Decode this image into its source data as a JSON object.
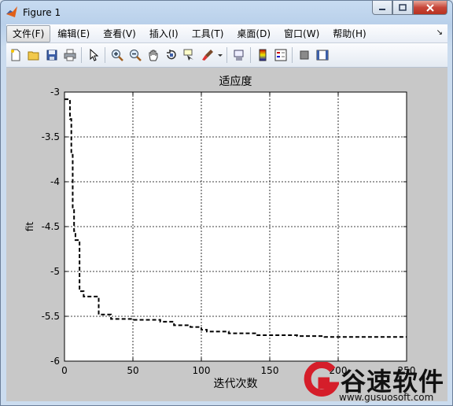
{
  "window": {
    "title": "Figure 1"
  },
  "menu": [
    {
      "label": "文件(F)"
    },
    {
      "label": "编辑(E)"
    },
    {
      "label": "查看(V)"
    },
    {
      "label": "插入(I)"
    },
    {
      "label": "工具(T)"
    },
    {
      "label": "桌面(D)"
    },
    {
      "label": "窗口(W)"
    },
    {
      "label": "帮助(H)"
    }
  ],
  "toolbar_icons": [
    "new-figure-icon",
    "open-file-icon",
    "save-icon",
    "print-icon",
    "edit-plot-arrow-icon",
    "zoom-in-icon",
    "zoom-out-icon",
    "pan-hand-icon",
    "rotate-3d-icon",
    "data-cursor-icon",
    "brush-icon",
    "link-plot-icon",
    "colorbar-icon",
    "legend-icon",
    "hide-plot-tools-icon",
    "show-plot-tools-icon"
  ],
  "watermark": {
    "brand": "谷速软件",
    "url": "www.gusuosoft.com"
  },
  "chart_data": {
    "type": "line",
    "title": "适应度",
    "xlabel": "迭代次数",
    "ylabel": "fit",
    "xlim": [
      0,
      250
    ],
    "ylim": [
      -6,
      -3
    ],
    "xticks": [
      "0",
      "50",
      "100",
      "150",
      "200",
      "250"
    ],
    "yticks": [
      "-3",
      "-3.5",
      "-4",
      "-4.5",
      "-5",
      "-5.5",
      "-6"
    ],
    "grid": true,
    "line_style": "dashed",
    "line_color": "#000000",
    "series": [
      {
        "x": [
          0,
          3,
          4,
          5,
          6,
          7,
          8,
          10,
          11,
          12,
          14,
          17,
          24,
          25,
          26,
          33,
          34,
          35,
          50,
          70,
          80,
          92,
          100,
          104,
          120,
          140,
          170,
          190,
          210,
          250
        ],
        "y": [
          -3.08,
          -3.08,
          -3.3,
          -3.7,
          -4.3,
          -4.55,
          -4.65,
          -4.65,
          -5.22,
          -5.22,
          -5.28,
          -5.28,
          -5.28,
          -5.48,
          -5.48,
          -5.48,
          -5.53,
          -5.53,
          -5.54,
          -5.56,
          -5.6,
          -5.62,
          -5.65,
          -5.67,
          -5.69,
          -5.71,
          -5.72,
          -5.73,
          -5.73,
          -5.73
        ]
      }
    ]
  }
}
